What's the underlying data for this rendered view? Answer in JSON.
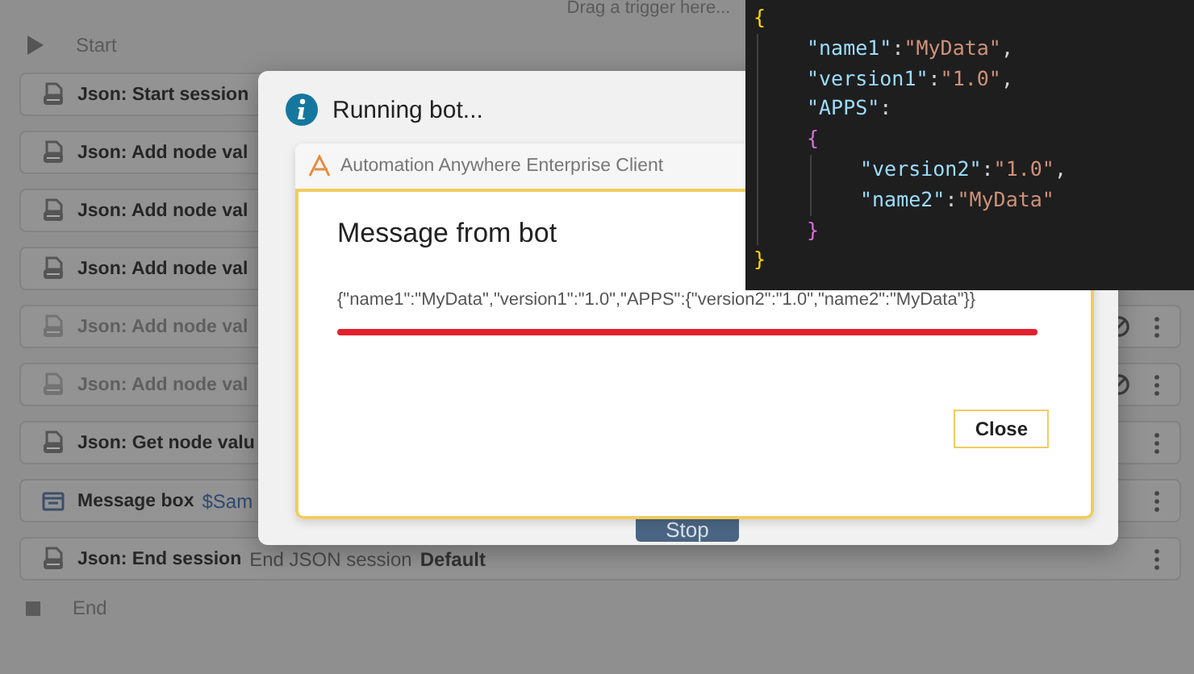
{
  "flow": {
    "drop_hint": "Drag a trigger here...",
    "start_label": "Start",
    "end_label": "End",
    "steps": [
      {
        "kind": "json",
        "title": "Json: Start session",
        "disabled": false
      },
      {
        "kind": "json",
        "title": "Json: Add node val",
        "disabled": false
      },
      {
        "kind": "json",
        "title": "Json: Add node val",
        "disabled": false
      },
      {
        "kind": "json",
        "title": "Json: Add node val",
        "disabled": false
      },
      {
        "kind": "json",
        "title": "Json: Add node val",
        "disabled": true
      },
      {
        "kind": "json",
        "title": "Json: Add node val",
        "disabled": true
      },
      {
        "kind": "json",
        "title": "Json: Get node valu",
        "disabled": false
      },
      {
        "kind": "message",
        "title": "Message box",
        "detail": "$Sam",
        "disabled": false
      },
      {
        "kind": "json",
        "title": "Json: End session",
        "detail": "End JSON session",
        "emphasis": "Default",
        "disabled": false
      }
    ]
  },
  "dialog": {
    "title": "Running bot...",
    "stop_button": "Stop",
    "client": {
      "title": "Automation Anywhere Enterprise Client",
      "heading": "Message from bot",
      "message": "{\"name1\":\"MyData\",\"version1\":\"1.0\",\"APPS\":{\"version2\":\"1.0\",\"name2\":\"MyData\"}}",
      "close_button": "Close"
    }
  },
  "code": {
    "open": "{",
    "close": "}",
    "entries": [
      {
        "key": "\"name1\"",
        "sep": ":",
        "value": "\"MyData\"",
        "comma": ","
      },
      {
        "key": "\"version1\"",
        "sep": ":",
        "value": "\"1.0\"",
        "comma": ","
      },
      {
        "key": "\"APPS\"",
        "sep": ":"
      }
    ],
    "block": {
      "open": "{",
      "close": "}",
      "entries": [
        {
          "key": "\"version2\"",
          "sep": ":",
          "value": "\"1.0\"",
          "comma": ","
        },
        {
          "key": "\"name2\"",
          "sep": ":",
          "value": "\"MyData\""
        }
      ]
    }
  }
}
